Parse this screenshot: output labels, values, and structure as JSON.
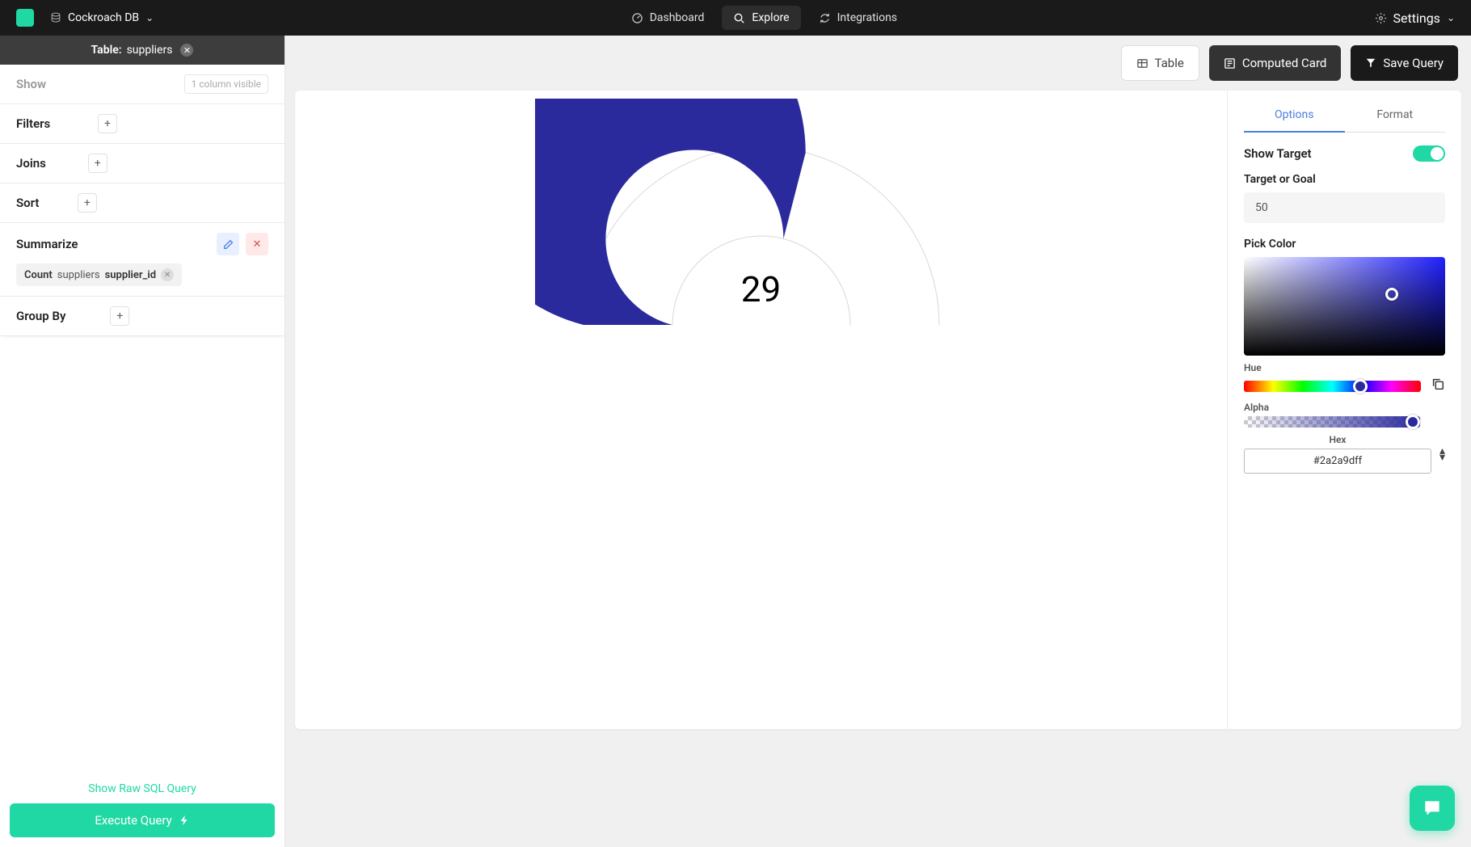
{
  "topbar": {
    "db_name": "Cockroach DB",
    "nav": {
      "dashboard": "Dashboard",
      "explore": "Explore",
      "integrations": "Integrations"
    },
    "settings": "Settings"
  },
  "sidebar": {
    "table_prefix": "Table:",
    "table_name": "suppliers",
    "show": {
      "label": "Show",
      "hint": "1 column visible"
    },
    "filters": {
      "label": "Filters"
    },
    "joins": {
      "label": "Joins"
    },
    "sort": {
      "label": "Sort"
    },
    "summarize": {
      "label": "Summarize",
      "chip": {
        "a": "Count",
        "b": "suppliers",
        "c": "supplier_id"
      }
    },
    "group_by": {
      "label": "Group By"
    },
    "footer": {
      "show_sql": "Show Raw SQL Query",
      "execute": "Execute Query"
    }
  },
  "toolbar": {
    "table": "Table",
    "computed": "Computed Card",
    "save": "Save Query"
  },
  "chart_data": {
    "type": "gauge",
    "value": 29,
    "target": 50,
    "color": "#2a2a9d",
    "display_value": "29"
  },
  "panel": {
    "tabs": {
      "options": "Options",
      "format": "Format"
    },
    "show_target": "Show Target",
    "target_label": "Target or Goal",
    "target_value": "50",
    "pick_color": "Pick Color",
    "hue_label": "Hue",
    "alpha_label": "Alpha",
    "hex_label": "Hex",
    "hex_value": "#2a2a9dff"
  }
}
